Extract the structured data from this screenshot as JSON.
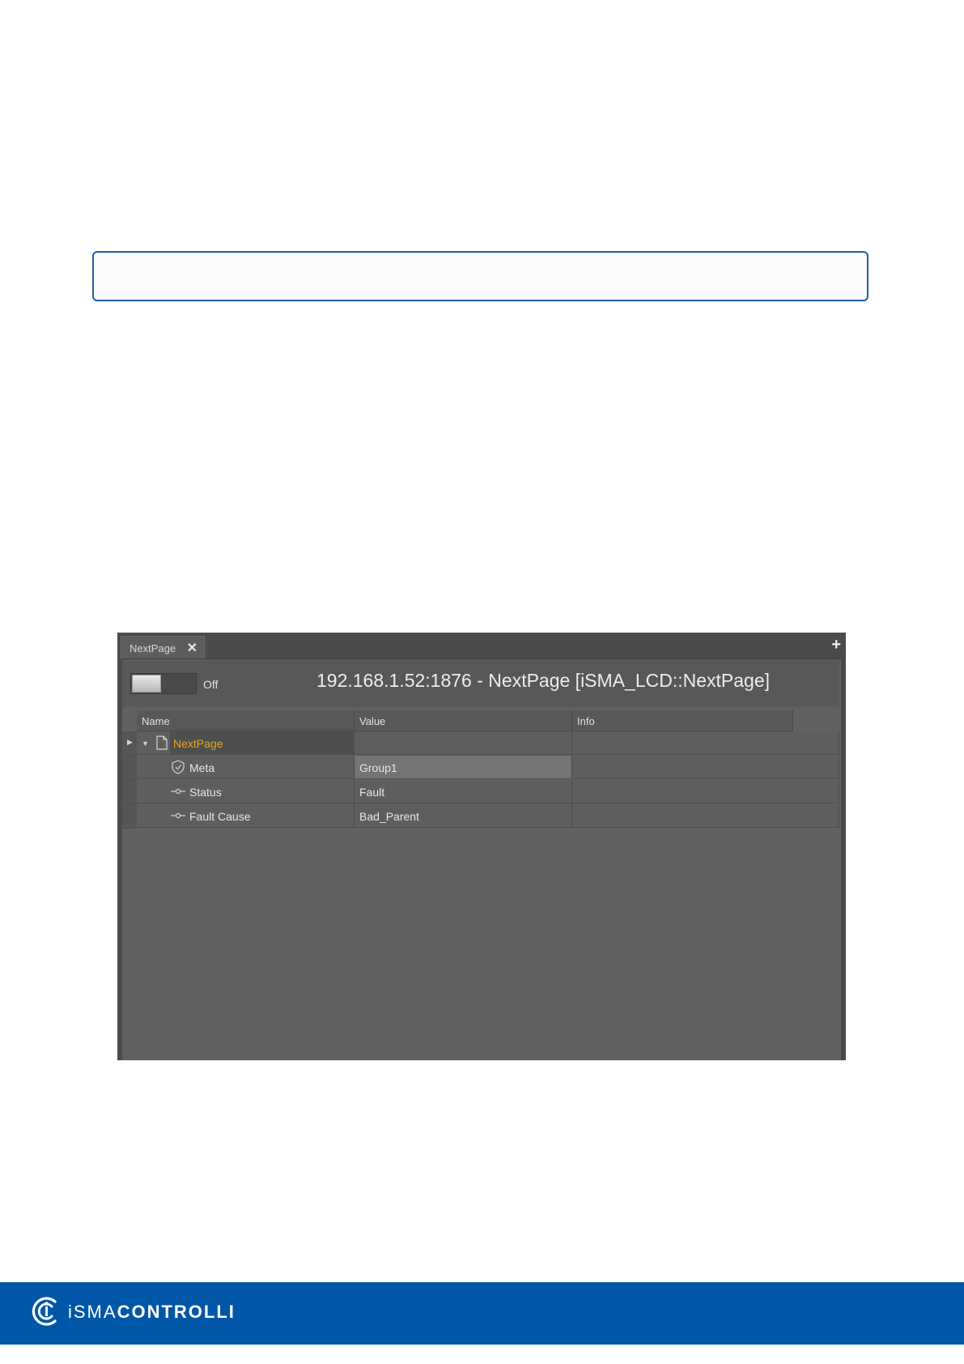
{
  "window": {
    "tab_label": "NextPage",
    "close_glyph": "✕",
    "add_glyph": "+",
    "toggle_state": "Off",
    "title": "192.168.1.52:1876 - NextPage [iSMA_LCD::NextPage]"
  },
  "table": {
    "columns": [
      "Name",
      "Value",
      "Info"
    ],
    "rows": [
      {
        "name": "NextPage",
        "value": "",
        "info": "",
        "icon": "document-icon"
      },
      {
        "name": "Meta",
        "value": "Group1",
        "info": "",
        "icon": "shield-icon"
      },
      {
        "name": "Status",
        "value": "Fault",
        "info": "",
        "icon": "slot-icon"
      },
      {
        "name": "Fault Cause",
        "value": "Bad_Parent",
        "info": "",
        "icon": "slot-icon"
      }
    ]
  },
  "brand": {
    "prefix": "iSMA",
    "suffix": "CONTROLLI"
  },
  "colors": {
    "footer": "#0057a8",
    "note_border": "#1f5fa8",
    "highlight_name": "#e8a322"
  }
}
